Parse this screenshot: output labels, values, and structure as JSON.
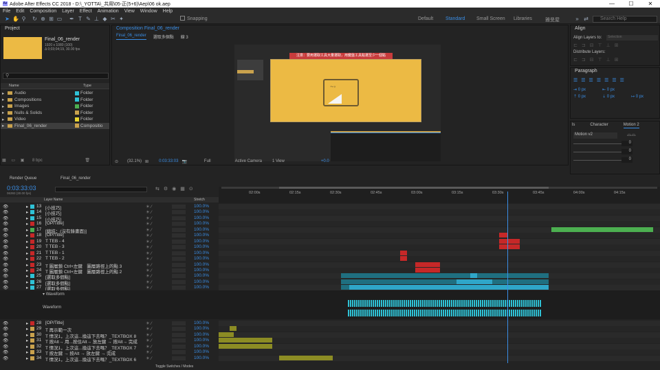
{
  "title": "Adobe After Effects CC 2018 - D:\\_YOTTA\\_共用\\05-正(5+6)\\Aep\\06 ok.aep",
  "window_controls": [
    "—",
    "☐",
    "✕"
  ],
  "menu": [
    "File",
    "Edit",
    "Composition",
    "Layer",
    "Effect",
    "Animation",
    "View",
    "Window",
    "Help"
  ],
  "toolbar": {
    "snapping": "Snapping",
    "workspaces": [
      "Default",
      "Standard",
      "Small Screen",
      "Libraries",
      "雅旻屋"
    ],
    "active_workspace": "Standard",
    "search_placeholder": "Search Help"
  },
  "project": {
    "title": "Project",
    "item_name": "Final_06_render",
    "item_size": "1920 x 1080 (100)",
    "item_dur": "Δ 0;03;04;19, 30.00 fps",
    "cols": [
      "Name",
      "Type"
    ],
    "items": [
      {
        "name": "Audio",
        "type": "Folder",
        "color": "#2fc2d6"
      },
      {
        "name": "Compositions",
        "type": "Folder",
        "color": "#2fc2d6"
      },
      {
        "name": "Images",
        "type": "Folder",
        "color": "#4caf50"
      },
      {
        "name": "Nulls & Solids",
        "type": "Folder",
        "color": "#c9a24d"
      },
      {
        "name": "Video",
        "type": "Folder",
        "color": "#e8d52f"
      },
      {
        "name": "Final_06_render",
        "type": "Compositio",
        "color": "#c9a24d"
      }
    ],
    "bpc": "8 bpc"
  },
  "comp": {
    "title": "Composition Final_06_render",
    "tabs": [
      "Final_06_render",
      "選取多個點",
      "線 3"
    ],
    "banner": "注意：要用選取工具大量選取，用鍵盤工具點選至少一個點",
    "zoom": "(32.1%)",
    "time": "0:03:33:03",
    "res": "Full",
    "camera": "Active Camera",
    "view": "1 View",
    "exposure": "+0.0"
  },
  "align": {
    "title": "Align",
    "align_to": "Align Layers to:",
    "align_to_val": "Selection",
    "distribute": "Distribute Layers:"
  },
  "paragraph": {
    "title": "Paragraph",
    "px": [
      "0 px",
      "0 px",
      "0 px",
      "0 px",
      "0 px"
    ]
  },
  "motion": {
    "tabs": [
      "ls",
      "Character",
      "Motion 2"
    ],
    "preset": "Motion v2",
    "vals": [
      "0",
      "0",
      "0"
    ]
  },
  "timeline": {
    "render_queue": "Render Queue",
    "comp_tab": "Final_06_render",
    "time": "0:03:33:03",
    "frames": "06393 (30.00 fps)",
    "col_layer": "Layer Name",
    "col_stretch": "Stretch",
    "ticks": [
      "02:00s",
      "02:15s",
      "02:30s",
      "02:45s",
      "03:00s",
      "03:15s",
      "03:30s",
      "03:45s",
      "04:00s",
      "04:15s"
    ],
    "layers": [
      {
        "n": "13",
        "name": "[小技巧]",
        "c": "#2fc2d6",
        "s": "100.0%"
      },
      {
        "n": "14",
        "name": "[小技巧]",
        "c": "#2fc2d6",
        "s": "100.0%"
      },
      {
        "n": "15",
        "name": "[小技巧]",
        "c": "#2fc2d6",
        "s": "100.0%"
      },
      {
        "n": "16",
        "name": "[OP/Title]",
        "c": "#c62828",
        "s": "100.0%"
      },
      {
        "n": "17",
        "name": "[總結：(沒有錄畫面)]",
        "c": "#4caf50",
        "s": "100.0%"
      },
      {
        "n": "18",
        "name": "[OP/Title]",
        "c": "#c62828",
        "s": "100.0%"
      },
      {
        "n": "19",
        "name": "T  TEB - 4",
        "c": "#c62828",
        "s": "100.0%"
      },
      {
        "n": "20",
        "name": "T  TEB - 3",
        "c": "#c62828",
        "s": "100.0%"
      },
      {
        "n": "21",
        "name": "T  TEB - 1",
        "c": "#c62828",
        "s": "100.0%"
      },
      {
        "n": "22",
        "name": "T  TEB - 2",
        "c": "#c62828",
        "s": "100.0%"
      },
      {
        "n": "23",
        "name": "T  圖層鎖 Ctrl+左鍵　圖層路徑上的點 3",
        "c": "#c62828",
        "s": "100.0%"
      },
      {
        "n": "24",
        "name": "T  圖層鎖 Ctrl+左鍵　圖層路徑上的點 2",
        "c": "#c62828",
        "s": "100.0%"
      },
      {
        "n": "25",
        "name": "[選取多個點]",
        "c": "#2fc2d6",
        "s": "100.0%"
      },
      {
        "n": "26",
        "name": "[選取多個點]",
        "c": "#2fc2d6",
        "s": "100.0%"
      },
      {
        "n": "27",
        "name": "[選取多個點]",
        "c": "#2fc2d6",
        "s": "100.0%"
      }
    ],
    "waveform": "Waveform",
    "layers2": [
      {
        "n": "28",
        "name": "[OP/Title]",
        "c": "#c62828",
        "s": "100.0%"
      },
      {
        "n": "29",
        "name": "T  再示範一次",
        "c": "#c9a24d",
        "s": "100.0%"
      },
      {
        "n": "30",
        "name": "T  情況1，上次這...換這下去嗎？_TEXTBOX 8",
        "c": "#c9a24d",
        "s": "100.0%"
      },
      {
        "n": "31",
        "name": "T  按Alt→ 用...按住Alt→ 放左鍵 → 按Alt→ 完成",
        "c": "#c9a24d",
        "s": "100.0%"
      },
      {
        "n": "32",
        "name": "T  情況1，上次這...換這下去嗎？_TEXTBOX 7",
        "c": "#c9a24d",
        "s": "100.0%"
      },
      {
        "n": "33",
        "name": "T  按左鍵 → 按Alt → 放左鍵 → 完成",
        "c": "#c9a24d",
        "s": "100.0%"
      },
      {
        "n": "34",
        "name": "T  情況1，上次這...換這下去嗎？_TEXTBOX 6",
        "c": "#c9a24d",
        "s": "100.0%"
      }
    ],
    "toggle": "Toggle Switches / Modes"
  }
}
